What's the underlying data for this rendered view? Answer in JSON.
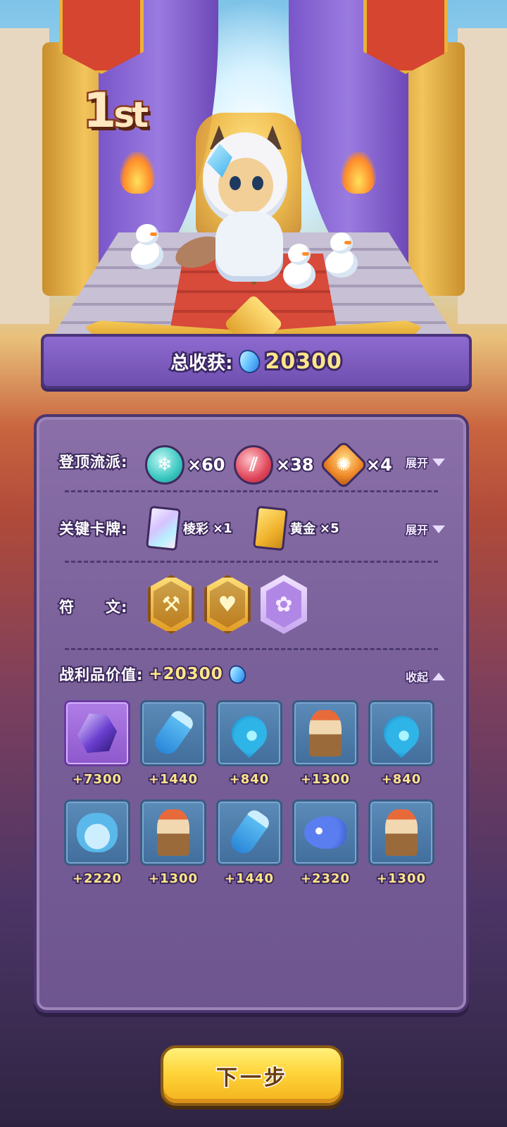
{
  "rank": {
    "number": "1",
    "suffix": "st"
  },
  "total": {
    "label": "总收获:",
    "value": "20300"
  },
  "sections": {
    "factions": {
      "label": "登顶流派:",
      "toggle": "展开",
      "items": [
        {
          "icon": "snowflake-icon",
          "glyph": "❄",
          "count": "×60"
        },
        {
          "icon": "claw-icon",
          "glyph": "⫽",
          "count": "×38"
        },
        {
          "icon": "flame-swirl-icon",
          "glyph": "✺",
          "count": "×4"
        }
      ]
    },
    "key_cards": {
      "label": "关键卡牌:",
      "toggle": "展开",
      "items": [
        {
          "name": "棱彩",
          "qty": "×1",
          "style": "rainbow"
        },
        {
          "name": "黄金",
          "qty": "×5",
          "style": "gold"
        }
      ]
    },
    "runes": {
      "label": "符　　文:",
      "items": [
        {
          "icon": "golden-hammer-rune-icon",
          "glyph": "⚒",
          "style": "g"
        },
        {
          "icon": "heart-swirl-rune-icon",
          "glyph": "♥",
          "style": "g"
        },
        {
          "icon": "card-rune-icon",
          "glyph": "✿",
          "style": "p"
        }
      ]
    },
    "loot": {
      "label": "战利品价值:",
      "value": "+20300",
      "toggle": "收起",
      "items": [
        {
          "icon": "purple-crystal-icon",
          "art": "crystal",
          "rarity": "epic",
          "value": "+7300"
        },
        {
          "icon": "blue-bottle-icon",
          "art": "bottle",
          "rarity": "rare",
          "value": "+1440"
        },
        {
          "icon": "water-drop-icon",
          "art": "drop",
          "rarity": "rare",
          "value": "+840"
        },
        {
          "icon": "bull-totem-icon",
          "art": "totem",
          "rarity": "rare",
          "value": "+1300"
        },
        {
          "icon": "water-drop-icon",
          "art": "drop",
          "rarity": "rare",
          "value": "+840"
        },
        {
          "icon": "potion-jar-icon",
          "art": "jar",
          "rarity": "rare",
          "value": "+2220"
        },
        {
          "icon": "bull-totem-icon",
          "art": "totem",
          "rarity": "rare",
          "value": "+1300"
        },
        {
          "icon": "blue-bottle-icon",
          "art": "bottle",
          "rarity": "rare",
          "value": "+1440"
        },
        {
          "icon": "puffer-fish-icon",
          "art": "fish",
          "rarity": "rare",
          "value": "+2320"
        },
        {
          "icon": "bull-totem-icon",
          "art": "totem",
          "rarity": "rare",
          "value": "+1300"
        }
      ]
    }
  },
  "next_button": {
    "label": "下一步"
  },
  "colors": {
    "accent_gold": "#ffe58a",
    "panel": "#7a619a",
    "outline": "#3e2a5e",
    "button": "#ffd43a"
  }
}
